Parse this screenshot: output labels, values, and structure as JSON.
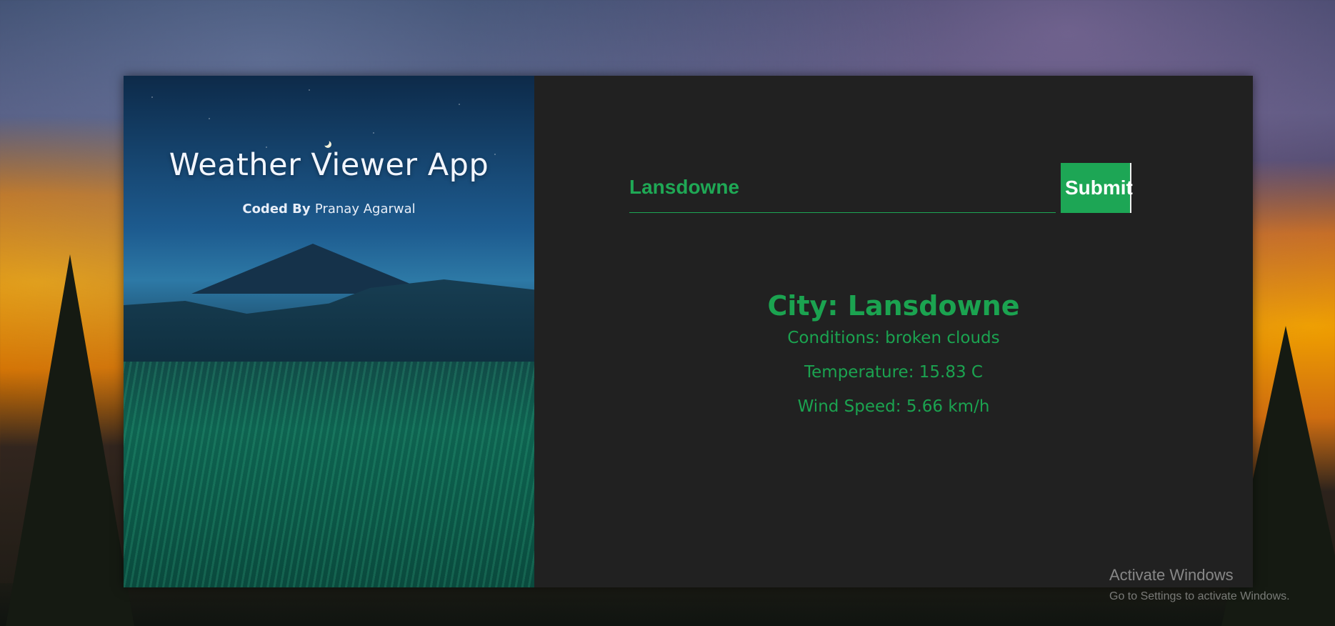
{
  "app": {
    "title": "Weather Viewer App",
    "credit_prefix": "Coded By",
    "credit_name": "Pranay Agarwal"
  },
  "search": {
    "value": "Lansdowne",
    "submit_label": "Submit"
  },
  "weather": {
    "city": "City: Lansdowne",
    "conditions": "Conditions: broken clouds",
    "temperature": "Temperature: 15.83 C",
    "wind_speed": "Wind Speed: 5.66 km/h"
  },
  "watermark": {
    "title": "Activate Windows",
    "subtitle": "Go to Settings to activate Windows."
  },
  "colors": {
    "accent": "#1DA655",
    "panel": "#212121"
  },
  "icons": [
    "moon-icon",
    "mountain-illustration"
  ]
}
